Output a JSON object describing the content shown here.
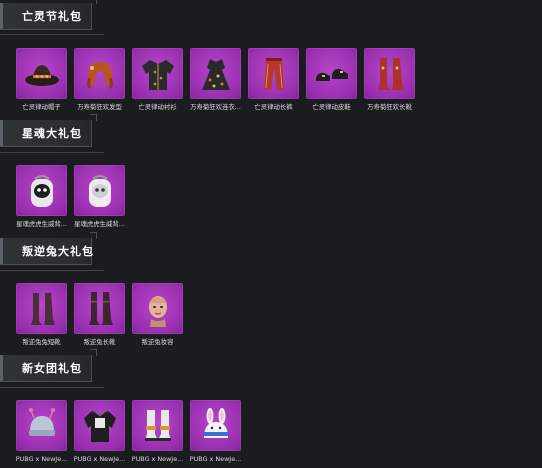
{
  "sections": [
    {
      "title": "亡灵节礼包",
      "items": [
        {
          "label": "亡灵律动帽子",
          "icon": "cowboy-hat-icon"
        },
        {
          "label": "万寿菊狂欢发型",
          "icon": "hairstyle-icon"
        },
        {
          "label": "亡灵律动衬衫",
          "icon": "shirt-icon"
        },
        {
          "label": "万寿菊狂欢连衣...",
          "icon": "dress-icon"
        },
        {
          "label": "亡灵律动长裤",
          "icon": "pants-icon"
        },
        {
          "label": "亡灵律动皮鞋",
          "icon": "shoes-icon"
        },
        {
          "label": "万寿菊狂欢长靴",
          "icon": "boots-icon"
        }
      ]
    },
    {
      "title": "星魂大礼包",
      "items": [
        {
          "label": "星魂虎虎生威背...",
          "icon": "backpack-icon"
        },
        {
          "label": "星魂虎虎生威背...",
          "icon": "backpack-icon"
        }
      ]
    },
    {
      "title": "叛逆兔大礼包",
      "items": [
        {
          "label": "叛逆兔兔短靴",
          "icon": "boots-icon"
        },
        {
          "label": "叛逆兔长靴",
          "icon": "boots-icon"
        },
        {
          "label": "叛逆兔妆容",
          "icon": "face-icon"
        }
      ]
    },
    {
      "title": "新女团礼包",
      "items": [
        {
          "label": "PUBG x NewJe...",
          "icon": "beanie-icon"
        },
        {
          "label": "PUBG x NewJe...",
          "icon": "jacket-icon"
        },
        {
          "label": "PUBG x NewJe...",
          "icon": "sneakers-icon"
        },
        {
          "label": "PUBG x NewJe...",
          "icon": "bunny-hat-icon"
        }
      ]
    }
  ]
}
